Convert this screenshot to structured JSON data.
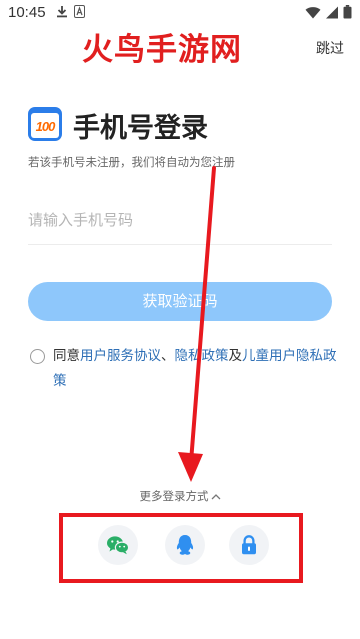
{
  "status_bar": {
    "time": "10:45",
    "left_icons": [
      "download-icon",
      "text-a-icon"
    ],
    "right_icons": [
      "wifi-icon",
      "signal-icon",
      "battery-icon"
    ]
  },
  "watermark": {
    "text": "火鸟手游网",
    "color": "#e11f1f"
  },
  "header": {
    "skip_label": "跳过",
    "logo_mark": "100",
    "title": "手机号登录",
    "subtitle": "若该手机号未注册，我们将自动为您注册"
  },
  "phone": {
    "placeholder": "请输入手机号码",
    "value": ""
  },
  "code_button": {
    "label": "获取验证码",
    "color": "#8ec7fb"
  },
  "agreement": {
    "checked": false,
    "prefix": "同意",
    "link_user_agreement": "用户服务协议",
    "sep1": "、",
    "link_privacy": "隐私政策",
    "sep2": "及",
    "link_child_privacy": "儿童用户隐私政策",
    "link_color": "#2e6fb6"
  },
  "more_login": {
    "label": "更多登录方式",
    "options": [
      {
        "name": "wechat",
        "icon": "wechat-icon",
        "color": "#2aae67"
      },
      {
        "name": "qq",
        "icon": "qq-icon",
        "color": "#2f8ff0"
      },
      {
        "name": "password",
        "icon": "lock-icon",
        "color": "#2f8ff0"
      }
    ]
  },
  "annotation": {
    "color": "#e8191f"
  }
}
